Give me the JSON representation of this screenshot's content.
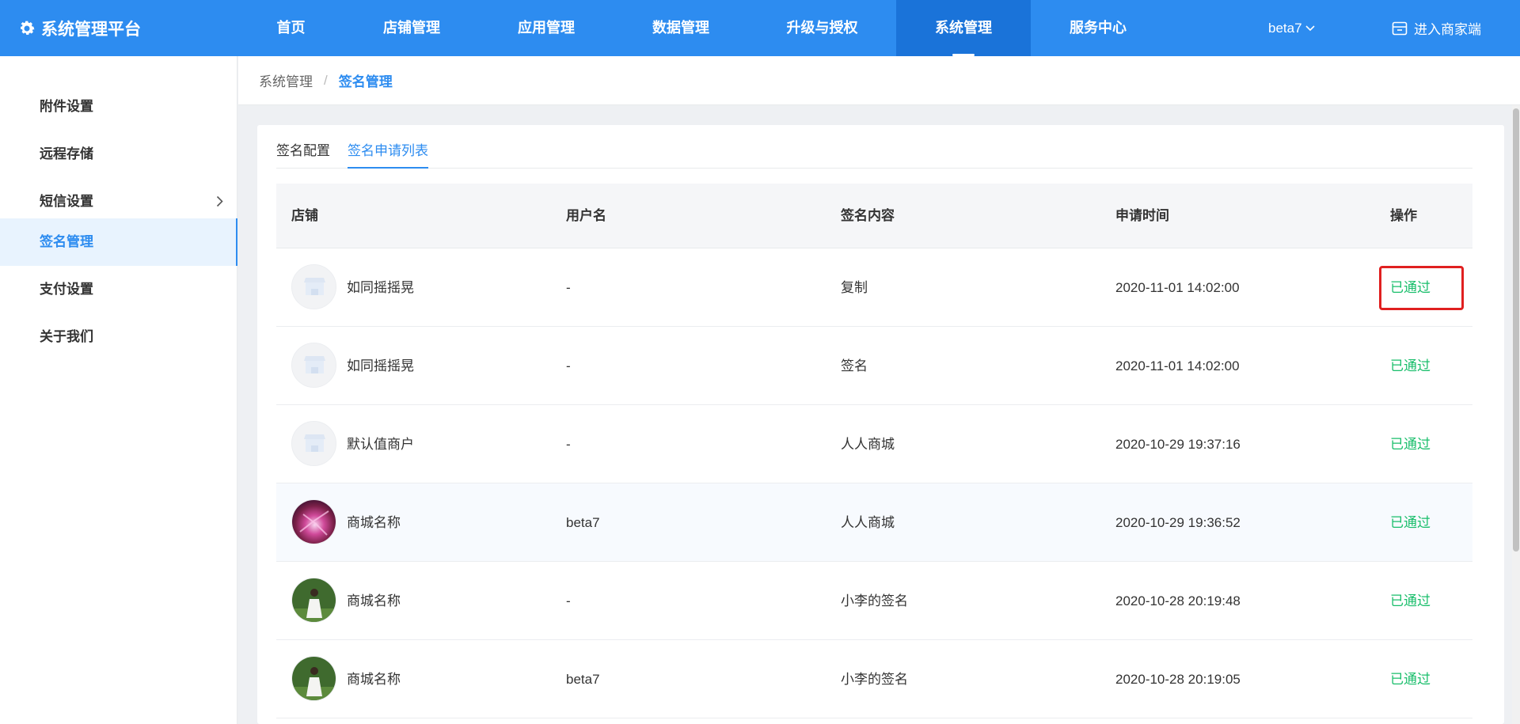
{
  "header": {
    "brand": "系统管理平台",
    "nav": [
      "首页",
      "店铺管理",
      "应用管理",
      "数据管理",
      "升级与授权",
      "系统管理",
      "服务中心"
    ],
    "user": "beta7",
    "merchant_link": "进入商家端"
  },
  "sidebar": {
    "items": [
      {
        "label": "附件设置"
      },
      {
        "label": "远程存储"
      },
      {
        "label": "短信设置"
      },
      {
        "label": "签名管理"
      },
      {
        "label": "支付设置"
      },
      {
        "label": "关于我们"
      }
    ]
  },
  "breadcrumb": {
    "root": "系统管理",
    "separator": "/",
    "current": "签名管理"
  },
  "tabs": [
    "签名配置",
    "签名申请列表"
  ],
  "table": {
    "headers": [
      "店铺",
      "用户名",
      "签名内容",
      "申请时间",
      "操作"
    ],
    "rows": [
      {
        "shop": "如同摇摇晃",
        "username": "-",
        "signature": "复制",
        "time": "2020-11-01 14:02:00",
        "action": "已通过",
        "avatar": "store-placeholder-icon"
      },
      {
        "shop": "如同摇摇晃",
        "username": "-",
        "signature": "签名",
        "time": "2020-11-01 14:02:00",
        "action": "已通过",
        "avatar": "store-placeholder-icon"
      },
      {
        "shop": "默认值商户",
        "username": "-",
        "signature": "人人商城",
        "time": "2020-10-29 19:37:16",
        "action": "已通过",
        "avatar": "store-placeholder-icon"
      },
      {
        "shop": "商城名称",
        "username": "beta7",
        "signature": "人人商城",
        "time": "2020-10-29 19:36:52",
        "action": "已通过",
        "avatar": "abstract-pink-avatar"
      },
      {
        "shop": "商城名称",
        "username": "-",
        "signature": "小李的签名",
        "time": "2020-10-28 20:19:48",
        "action": "已通过",
        "avatar": "person-photo-avatar"
      },
      {
        "shop": "商城名称",
        "username": "beta7",
        "signature": "小李的签名",
        "time": "2020-10-28 20:19:05",
        "action": "已通过",
        "avatar": "person-photo-avatar"
      }
    ]
  },
  "colors": {
    "primary": "#2d8cf0",
    "success": "#19be6b",
    "highlight": "#e02020"
  }
}
